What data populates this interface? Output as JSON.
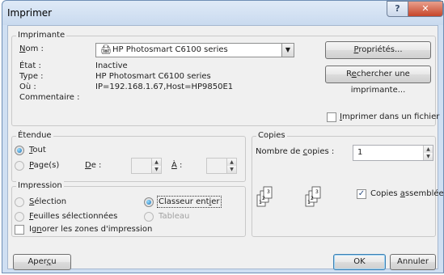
{
  "window": {
    "title": "Imprimer",
    "help_glyph": "?",
    "close_glyph": "✕"
  },
  "printer": {
    "group_label": "Imprimante",
    "name_label": "Nom :",
    "name_value": "HP Photosmart C6100 series",
    "status_label": "État :",
    "status_value": "Inactive",
    "type_label": "Type :",
    "type_value": "HP Photosmart C6100 series",
    "where_label": "Où :",
    "where_value": "IP=192.168.1.67,Host=HP9850E1",
    "comment_label": "Commentaire :",
    "properties_button": "Propriétés...",
    "find_button": "Rechercher une imprimante...",
    "print_to_file_label": "Imprimer dans un fichier",
    "print_to_file_checked": false
  },
  "range": {
    "group_label": "Étendue",
    "all_label": "Tout",
    "pages_label": "Page(s)",
    "from_label": "De :",
    "to_label": "À :",
    "selected": "all"
  },
  "copies": {
    "group_label": "Copies",
    "count_label": "Nombre de copies :",
    "count_value": "1",
    "collate_label": "Copies assemblées",
    "collate_checked": true
  },
  "print_what": {
    "group_label": "Impression",
    "selection_label": "Sélection",
    "workbook_label": "Classeur entier",
    "sheets_label": "Feuilles sélectionnées",
    "table_label": "Tableau",
    "ignore_label": "Ignorer les zones d'impression",
    "selected": "workbook"
  },
  "footer": {
    "preview_button": "Aperçu",
    "ok_button": "OK",
    "cancel_button": "Annuler"
  }
}
